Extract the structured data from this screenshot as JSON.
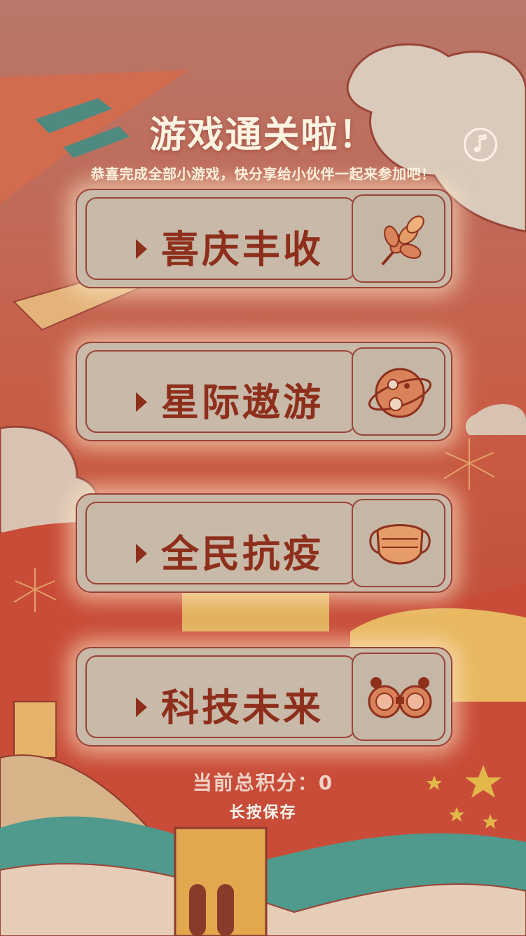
{
  "header": {
    "title": "游戏通关啦！",
    "subtitle": "恭喜完成全部小游戏，快分享给小伙伴一起来参加吧！"
  },
  "games": [
    {
      "label": "喜庆丰收",
      "icon": "wheat-icon"
    },
    {
      "label": "星际遨游",
      "icon": "planet-icon"
    },
    {
      "label": "全民抗疫",
      "icon": "mask-icon"
    },
    {
      "label": "科技未来",
      "icon": "vr-goggles-icon"
    }
  ],
  "footer": {
    "score_text": "当前总积分：0",
    "save_text": "长按保存"
  },
  "colors": {
    "background": "#c05a46",
    "button_bg": "#c8b9a9",
    "button_text": "#8e2f1c",
    "glow": "#ffe8c8"
  }
}
